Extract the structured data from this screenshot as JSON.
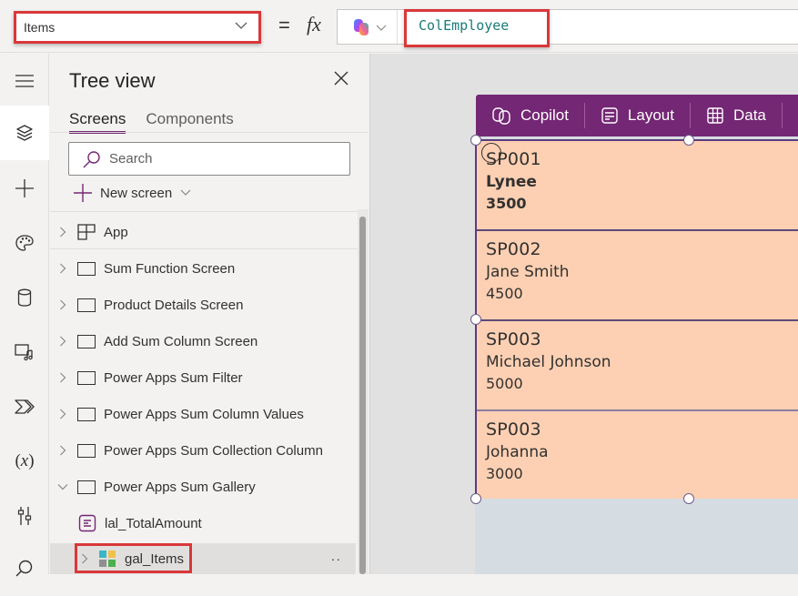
{
  "formula_bar": {
    "property": "Items",
    "equals": "=",
    "fx": "fx",
    "formula": "ColEmployee"
  },
  "left_rail": {
    "items": [
      {
        "icon": "hamburger-menu-icon"
      },
      {
        "icon": "tree-view-layers-icon",
        "active": true
      },
      {
        "icon": "insert-plus-icon"
      },
      {
        "icon": "theme-palette-icon"
      },
      {
        "icon": "data-cylinder-icon"
      },
      {
        "icon": "media-icon"
      },
      {
        "icon": "power-automate-icon"
      },
      {
        "icon": "variables-icon",
        "text": "(x)"
      },
      {
        "icon": "advanced-tools-icon"
      },
      {
        "icon": "search-icon"
      }
    ]
  },
  "tree_view": {
    "title": "Tree view",
    "tabs": [
      {
        "label": "Screens",
        "active": true
      },
      {
        "label": "Components",
        "active": false
      }
    ],
    "search_placeholder": "Search",
    "new_screen_label": "New screen",
    "items": [
      {
        "label": "App",
        "type": "app",
        "expanded": false
      },
      {
        "label": "Sum Function Screen",
        "type": "screen",
        "expanded": false
      },
      {
        "label": "Product Details Screen",
        "type": "screen",
        "expanded": false
      },
      {
        "label": "Add Sum Column Screen",
        "type": "screen",
        "expanded": false
      },
      {
        "label": "Power Apps Sum Filter",
        "type": "screen",
        "expanded": false
      },
      {
        "label": "Power Apps Sum Column Values",
        "type": "screen",
        "expanded": false
      },
      {
        "label": "Power Apps Sum Collection Column",
        "type": "screen",
        "expanded": false
      },
      {
        "label": "Power Apps Sum Gallery",
        "type": "screen",
        "expanded": true
      },
      {
        "label": "lal_TotalAmount",
        "type": "label",
        "indent": 1
      },
      {
        "label": "gal_Items",
        "type": "gallery",
        "indent": 1,
        "selected": true,
        "more": "··"
      }
    ]
  },
  "gallery_toolbar": {
    "buttons": [
      {
        "label": "Copilot",
        "icon": "copilot-icon"
      },
      {
        "label": "Layout",
        "icon": "layout-icon"
      },
      {
        "label": "Data",
        "icon": "data-table-icon"
      }
    ]
  },
  "gallery": {
    "fill_color": "#fdd0b3",
    "rows": [
      {
        "id": "SP001",
        "name": "Lynee",
        "amount": "3500"
      },
      {
        "id": "SP002",
        "name": "Jane Smith",
        "amount": "4500"
      },
      {
        "id": "SP003",
        "name": "Michael Johnson",
        "amount": "5000"
      },
      {
        "id": "SP003",
        "name": "Johanna",
        "amount": "3000"
      }
    ]
  },
  "colors": {
    "accent": "#742774",
    "highlight_border": "#d9373a",
    "formula_text": "#1a7a7a"
  }
}
